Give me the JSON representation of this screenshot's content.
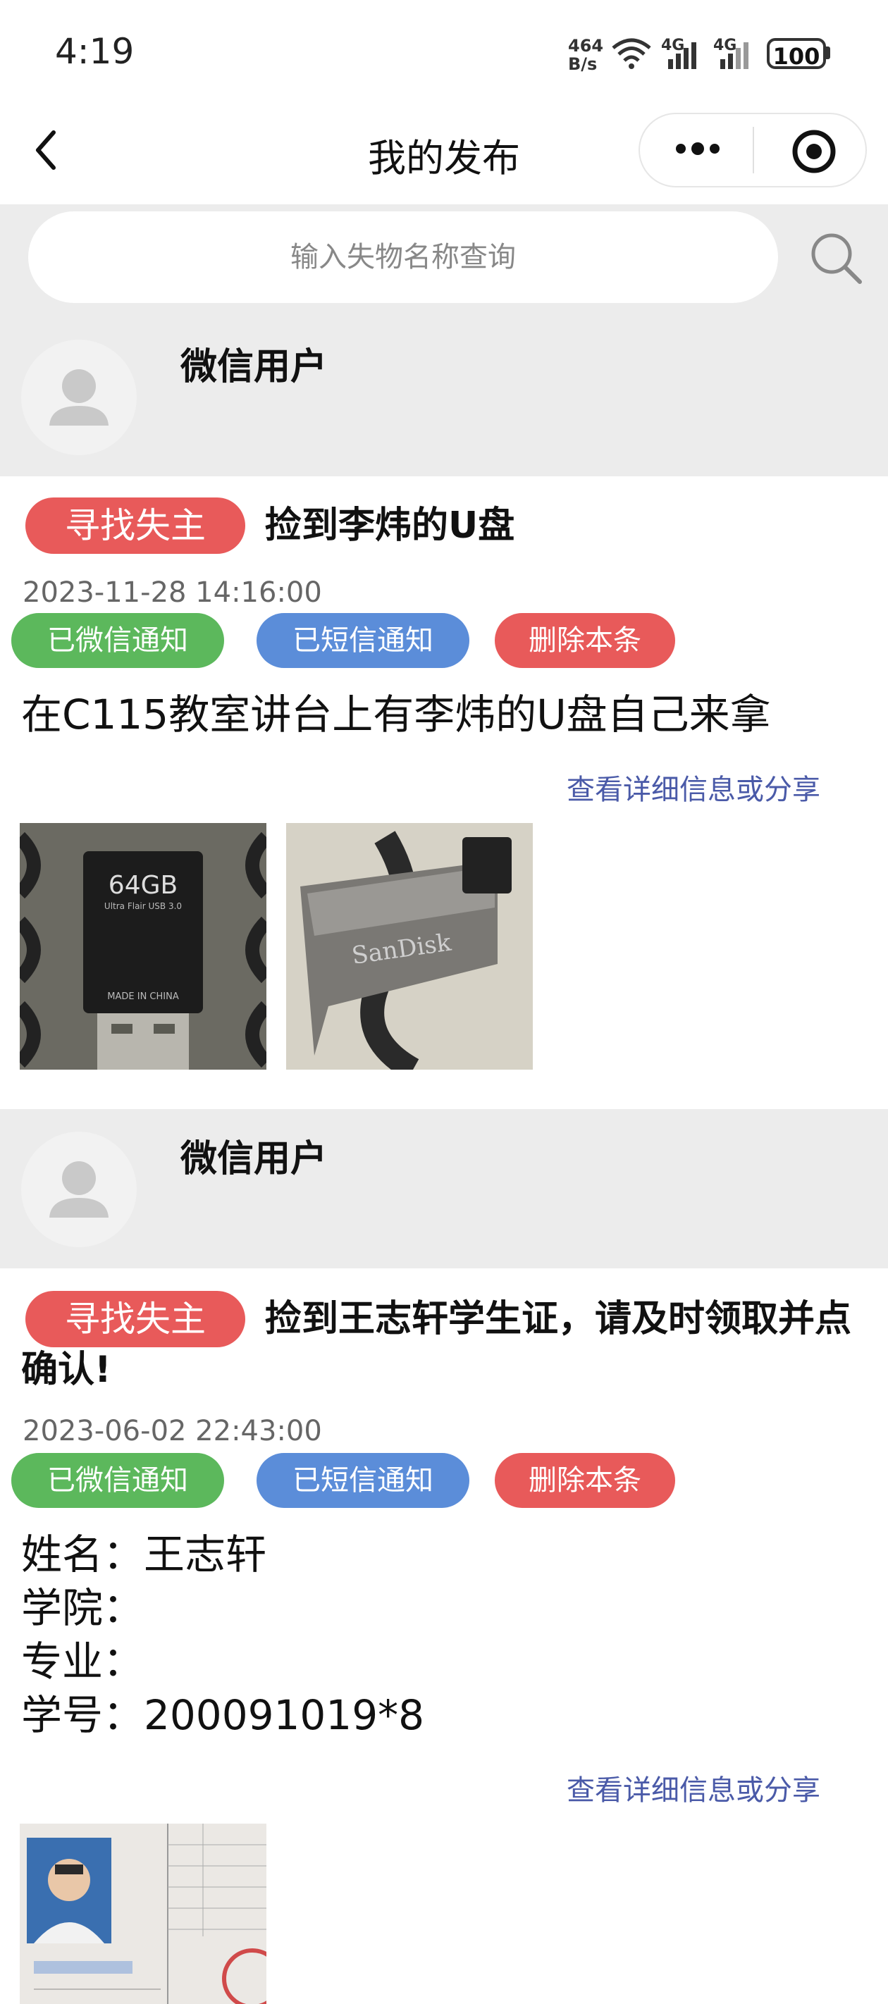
{
  "status_bar": {
    "time": "4:19",
    "net_speed": "464\nB/s",
    "signal_1": "4G",
    "signal_2": "4G",
    "battery": "100"
  },
  "nav": {
    "title": "我的发布",
    "back_icon": "chevron-left-icon",
    "more_icon": "more-dots-icon",
    "target_icon": "target-icon"
  },
  "search": {
    "placeholder": "输入失物名称查询",
    "icon": "search-icon"
  },
  "posts": [
    {
      "user_name": "微信用户",
      "tag": "寻找失主",
      "title": "捡到李炜的U盘",
      "date": "2023-11-28 14:16:00",
      "btn_wechat": "已微信通知",
      "btn_sms": "已短信通知",
      "btn_delete": "删除本条",
      "description": "在C115教室讲台上有李炜的U盘自己来拿",
      "share_link": "查看详细信息或分享",
      "images": [
        {
          "label": "64GB",
          "sub": "Ultra Flair USB 3.0",
          "extra": "MADE IN CHINA"
        },
        {
          "label": "SanDisk"
        }
      ]
    },
    {
      "user_name": "微信用户",
      "tag": "寻找失主",
      "title": "捡到王志轩学生证，请及时领取并点确认!",
      "date": "2023-06-02 22:43:00",
      "btn_wechat": "已微信通知",
      "btn_sms": "已短信通知",
      "btn_delete": "删除本条",
      "description": "姓名：王志轩\n学院：\n专业：\n学号：200091019*8",
      "share_link": "查看详细信息或分享"
    }
  ],
  "colors": {
    "tag_red": "#e85a5a",
    "btn_green": "#5cb85c",
    "btn_blue": "#5b8dd9",
    "link_blue": "#4a5aa8",
    "strip_gray": "#ececec"
  }
}
